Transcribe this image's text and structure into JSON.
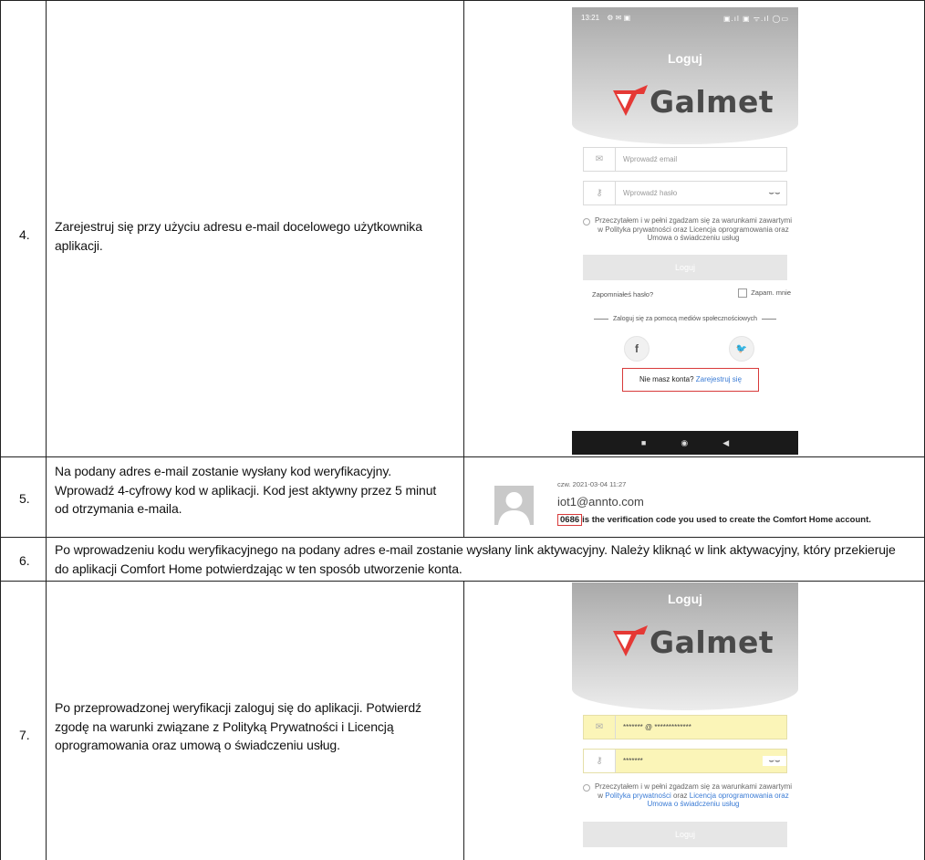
{
  "rows": [
    {
      "num": "4.",
      "text": "Zarejestruj się przy użyciu adresu e-mail docelowego użytkownika aplikacji."
    },
    {
      "num": "5.",
      "text": "Na podany adres e-mail zostanie wysłany kod weryfikacyjny. Wprowadź 4-cyfrowy kod w aplikacji. Kod jest aktywny przez 5 minut od otrzymania e-maila."
    },
    {
      "num": "6.",
      "text": "Po wprowadzeniu kodu weryfikacyjnego na podany adres e-mail zostanie wysłany link aktywacyjny. Należy kliknąć w link aktywacyjny, który przekieruje do aplikacji Comfort Home potwierdzając w ten sposób utworzenie konta."
    },
    {
      "num": "7.",
      "text": "Po przeprowadzonej weryfikacji zaloguj się do aplikacji. Potwierdź zgodę na warunki związane z Polityką Prywatności i Licencją oprogramowania oraz umową o świadczeniu usług."
    }
  ],
  "phone1": {
    "status_time": "13:21",
    "status_right": "▣.ıl ▣ ᯤ.ıl ◯▭",
    "title": "Loguj",
    "logo_text": "Galmet",
    "email_placeholder": "Wprowadź email",
    "password_placeholder": "Wprowadź hasło",
    "terms_text": "Przeczytałem i w pełni zgadzam się za warunkami zawartymi w Polityka prywatności oraz Licencja oprogramowania oraz Umowa o świadczeniu usług",
    "login_label": "Loguj",
    "forgot_label": "Zapomniałeś hasło?",
    "remember_label": "Zapam. mnie",
    "social_label": "Zaloguj się za pomocą mediów społecznościowych",
    "facebook_glyph": "f",
    "twitter_glyph": "🐦",
    "no_account": "Nie masz konta?",
    "register_link": "Zarejestruj się",
    "nav_square": "■",
    "nav_circle": "◉",
    "nav_back": "◀"
  },
  "email": {
    "date": "czw. 2021-03-04 11:27",
    "from": "iot1@annto.com",
    "code": "0686",
    "body_rest": "is the verification code you used to create the Comfort Home account."
  },
  "phone2": {
    "title": "Loguj",
    "logo_text": "Galmet",
    "email_value": "******* @ *************",
    "password_value": "*******",
    "terms_prefix": "Przeczytałem i w pełni zgadzam się za warunkami zawartymi w",
    "terms_link1": "Polityka prywatności",
    "terms_mid": "oraz",
    "terms_link2": "Licencja oprogramowania oraz Umowa o świadczeniu usług",
    "login_label": "Loguj"
  },
  "colors": {
    "accent_red": "#d83a3a",
    "link_blue": "#3a7bd5",
    "logo_red": "#e53935"
  }
}
